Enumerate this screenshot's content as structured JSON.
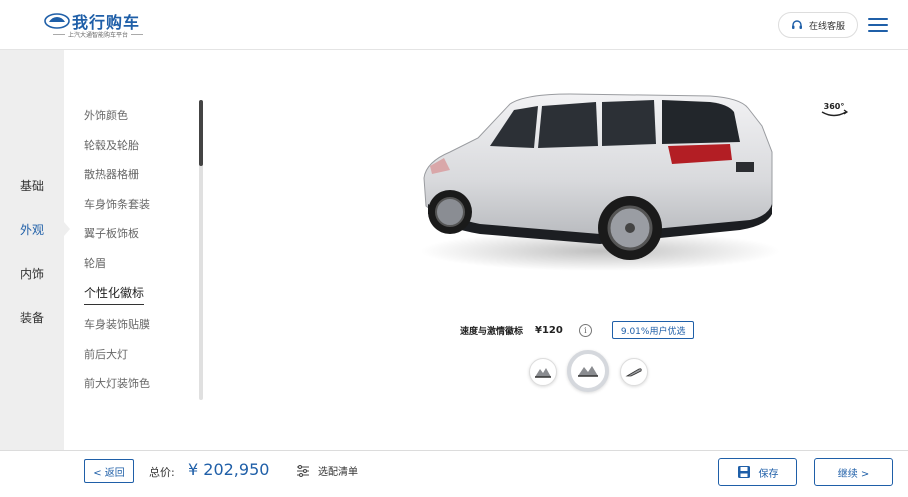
{
  "header": {
    "logo_title": "我行购车",
    "logo_subtitle": "上汽大通智能购车平台",
    "service_label": "在线客服",
    "logo_icon": "car-logo-icon",
    "menu_icon": "hamburger-menu-icon"
  },
  "categories": [
    {
      "label": "基础"
    },
    {
      "label": "外观"
    },
    {
      "label": "内饰"
    },
    {
      "label": "装备"
    }
  ],
  "active_category": "外观",
  "sub_items": [
    {
      "label": "外饰颜色"
    },
    {
      "label": "轮毂及轮胎"
    },
    {
      "label": "散热器格栅"
    },
    {
      "label": "车身饰条套装"
    },
    {
      "label": "翼子板饰板"
    },
    {
      "label": "轮眉"
    },
    {
      "label": "个性化徽标"
    },
    {
      "label": "车身装饰贴膜"
    },
    {
      "label": "前后大灯"
    },
    {
      "label": "前大灯装饰色"
    }
  ],
  "active_sub_item": "个性化徽标",
  "viewer": {
    "view_360_label": "360°"
  },
  "option": {
    "name": "速度与激情徽标",
    "price": "¥120",
    "info_icon": "info-icon",
    "preference_badge": "9.01%用户优选"
  },
  "swatches": [
    {
      "name": "badge-option-1",
      "selected": false
    },
    {
      "name": "badge-option-2",
      "selected": true
    },
    {
      "name": "badge-option-3",
      "selected": false
    }
  ],
  "footer": {
    "back_label": "< 返回",
    "total_label": "总价:",
    "total_price": "¥ 202,950",
    "config_list_label": "选配清单",
    "save_label": "保存",
    "next_label": "继续 >"
  },
  "colors": {
    "accent": "#1f5fa8",
    "sidebar_bg": "#eeeeee",
    "text": "#333333"
  }
}
